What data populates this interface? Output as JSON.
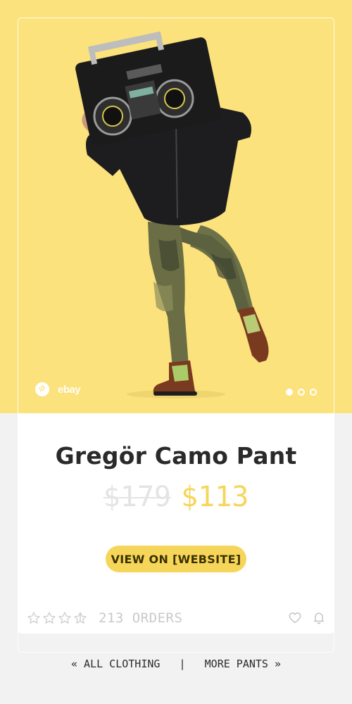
{
  "product": {
    "title": "Gregör Camo Pant",
    "price_old": "$179",
    "price_new": "$113",
    "cta_label": "VIEW ON [WEBSITE]",
    "orders_label": "213 ORDERS",
    "rating_stars": 3.5,
    "rating_max": 5
  },
  "gallery": {
    "brand_label": "ebay",
    "slide_count": 3,
    "active_slide": 1
  },
  "footer": {
    "left_link": "« ALL CLOTHING",
    "separator": "|",
    "right_link": "MORE PANTS »"
  },
  "colors": {
    "hero_background": "#fbe27d",
    "accent": "#f6d65a",
    "page_background": "#f2f2f2"
  },
  "icons": {
    "share": "pinterest-icon",
    "favorite": "heart-icon",
    "notify": "bell-icon",
    "rating": "star-icon"
  }
}
